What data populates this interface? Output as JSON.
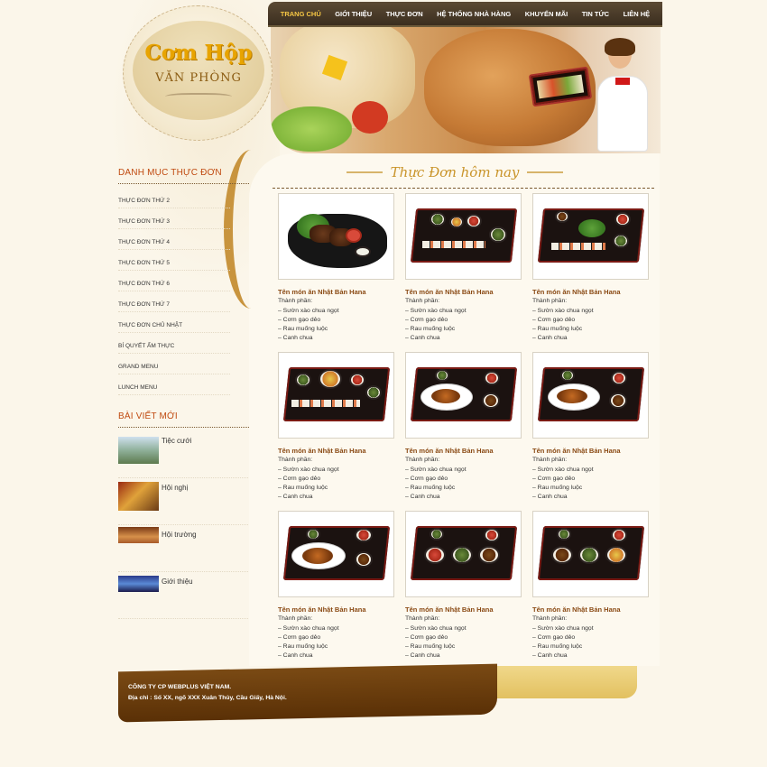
{
  "logo": {
    "title": "Cơm Hộp",
    "subtitle": "VĂN PHÒNG"
  },
  "nav": {
    "items": [
      {
        "label": "TRANG CHỦ",
        "active": true
      },
      {
        "label": "GIỚI THIỆU"
      },
      {
        "label": "THỰC ĐƠN"
      },
      {
        "label": "HỆ THỐNG NHÀ HÀNG"
      },
      {
        "label": "KHUYẾN MÃI"
      },
      {
        "label": "TIN TỨC"
      },
      {
        "label": "LIÊN HỆ"
      }
    ]
  },
  "sidebar": {
    "menu_heading": "DANH MỤC THỰC ĐƠN",
    "menu_items": [
      "THỰC ĐƠN THỨ 2",
      "THỰC ĐƠN THỨ 3",
      "THỰC ĐƠN THỨ 4",
      "THỰC ĐƠN THỨ 5",
      "THỰC ĐƠN THỨ 6",
      "THỰC ĐƠN THỨ 7",
      "THỰC ĐƠN CHỦ NHẬT",
      "BÍ QUYẾT ẨM THỰC",
      "GRAND MENU",
      "LUNCH MENU"
    ],
    "posts_heading": "BÀI VIẾT MỚI",
    "posts": [
      {
        "title": "Tiệc cưới"
      },
      {
        "title": "Hội nghị"
      },
      {
        "title": "Hội trường"
      },
      {
        "title": "Giới thiệu"
      }
    ]
  },
  "main": {
    "section_title": "Thực Đơn hôm nay",
    "dishes": [
      {
        "name": "Tên món ăn Nhật Bản Hana",
        "label": "Thành phần:",
        "ingredients": [
          "– Sườn xào chua ngọt",
          "– Cơm gạo dẻo",
          "– Rau muống luộc",
          "– Canh chua"
        ]
      },
      {
        "name": "Tên món ăn Nhật Bản Hana",
        "label": "Thành phần:",
        "ingredients": [
          "– Sườn xào chua ngọt",
          "– Cơm gạo dẻo",
          "– Rau muống luộc",
          "– Canh chua"
        ]
      },
      {
        "name": "Tên món ăn Nhật Bản Hana",
        "label": "Thành phần:",
        "ingredients": [
          "– Sườn xào chua ngọt",
          "– Cơm gạo dẻo",
          "– Rau muống luộc",
          "– Canh chua"
        ]
      },
      {
        "name": "Tên món ăn Nhật Bản Hana",
        "label": "Thành phần:",
        "ingredients": [
          "– Sườn xào chua ngọt",
          "– Cơm gạo dẻo",
          "– Rau muống luộc",
          "– Canh chua"
        ]
      },
      {
        "name": "Tên món ăn Nhật Bản Hana",
        "label": "Thành phần:",
        "ingredients": [
          "– Sườn xào chua ngọt",
          "– Cơm gạo dẻo",
          "– Rau muống luộc",
          "– Canh chua"
        ]
      },
      {
        "name": "Tên món ăn Nhật Bản Hana",
        "label": "Thành phần:",
        "ingredients": [
          "– Sườn xào chua ngọt",
          "– Cơm gạo dẻo",
          "– Rau muống luộc",
          "– Canh chua"
        ]
      },
      {
        "name": "Tên món ăn Nhật Bản Hana",
        "label": "Thành phần:",
        "ingredients": [
          "– Sườn xào chua ngọt",
          "– Cơm gạo dẻo",
          "– Rau muống luộc",
          "– Canh chua"
        ]
      },
      {
        "name": "Tên món ăn Nhật Bản Hana",
        "label": "Thành phần:",
        "ingredients": [
          "– Sườn xào chua ngọt",
          "– Cơm gạo dẻo",
          "– Rau muống luộc",
          "– Canh chua"
        ]
      },
      {
        "name": "Tên món ăn Nhật Bản Hana",
        "label": "Thành phần:",
        "ingredients": [
          "– Sườn xào chua ngọt",
          "– Cơm gạo dẻo",
          "– Rau muống luộc",
          "– Canh chua"
        ]
      }
    ]
  },
  "footer": {
    "company": "CÔNG TY CP WEBPLUS VIỆT NAM.",
    "address": "Địa chỉ : Số XX, ngõ XXX Xuân Thủy, Cầu Giấy, Hà Nội."
  },
  "colors": {
    "nav_bg": "#3b2e1f",
    "nav_active": "#f6c744",
    "heading_red": "#c04a10",
    "dish_name": "#8a4a14",
    "footer_brown": "#5a3006",
    "footer_yellow": "#e2c060"
  }
}
